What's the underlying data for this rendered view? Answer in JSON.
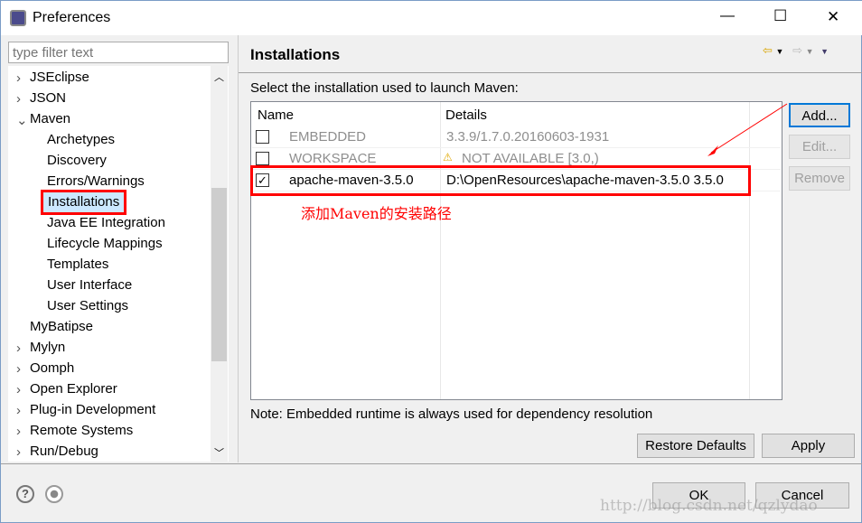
{
  "window": {
    "title": "Preferences",
    "minimize": "—",
    "maximize": "☐",
    "close": "✕"
  },
  "filter": {
    "placeholder": "type filter text"
  },
  "tree": {
    "items": [
      {
        "label": "JSEclipse",
        "level": 0,
        "arrow": "›"
      },
      {
        "label": "JSON",
        "level": 0,
        "arrow": "›"
      },
      {
        "label": "Maven",
        "level": 0,
        "arrow": "⌄"
      },
      {
        "label": "Archetypes",
        "level": 1
      },
      {
        "label": "Discovery",
        "level": 1
      },
      {
        "label": "Errors/Warnings",
        "level": 1
      },
      {
        "label": "Installations",
        "level": 1,
        "selected": true
      },
      {
        "label": "Java EE Integration",
        "level": 1
      },
      {
        "label": "Lifecycle Mappings",
        "level": 1
      },
      {
        "label": "Templates",
        "level": 1
      },
      {
        "label": "User Interface",
        "level": 1
      },
      {
        "label": "User Settings",
        "level": 1
      },
      {
        "label": "MyBatipse",
        "level": 0
      },
      {
        "label": "Mylyn",
        "level": 0,
        "arrow": "›"
      },
      {
        "label": "Oomph",
        "level": 0,
        "arrow": "›"
      },
      {
        "label": "Open Explorer",
        "level": 0,
        "arrow": "›"
      },
      {
        "label": "Plug-in Development",
        "level": 0,
        "arrow": "›"
      },
      {
        "label": "Remote Systems",
        "level": 0,
        "arrow": "›"
      },
      {
        "label": "Run/Debug",
        "level": 0,
        "arrow": "›"
      }
    ]
  },
  "page": {
    "title": "Installations",
    "prompt": "Select the installation used to launch Maven:",
    "columns": [
      "Name",
      "Details"
    ],
    "rows": [
      {
        "checked": false,
        "name": "EMBEDDED",
        "details": "3.3.9/1.7.0.20160603-1931",
        "disabled": true
      },
      {
        "checked": false,
        "name": "WORKSPACE",
        "details": "NOT AVAILABLE [3.0,)",
        "disabled": true,
        "warning": true
      },
      {
        "checked": true,
        "name": "apache-maven-3.5.0",
        "details": "D:\\OpenResources\\apache-maven-3.5.0 3.5.0"
      }
    ],
    "annotation": "添加Maven的安装路径",
    "note": "Note: Embedded runtime is always used for dependency resolution",
    "add": "Add...",
    "edit": "Edit...",
    "remove": "Remove",
    "restore": "Restore Defaults",
    "apply": "Apply"
  },
  "footer": {
    "ok": "OK",
    "cancel": "Cancel"
  },
  "watermark": "http://blog.csdn.net/qzlydao",
  "colors": {
    "highlight": "#ff0000",
    "selection": "#cce8ff",
    "focus": "#0078d7"
  }
}
